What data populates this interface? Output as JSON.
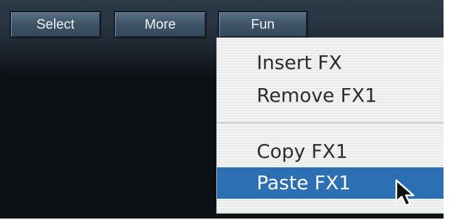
{
  "toolbar": {
    "buttons": [
      {
        "label": "Select"
      },
      {
        "label": "More"
      },
      {
        "label": "Fun"
      }
    ]
  },
  "menu": {
    "items": [
      {
        "label": "Insert FX"
      },
      {
        "label": "Remove FX1"
      },
      {
        "label": "Copy FX1"
      },
      {
        "label": "Paste FX1",
        "highlighted": true
      }
    ]
  },
  "colors": {
    "background": "#0c1115",
    "toolbar_button": "#3f5668",
    "menu_background": "#eceeef",
    "menu_highlight": "#2c6fb3",
    "menu_text": "#2a2c2e"
  },
  "icons": {
    "cursor": "arrow-pointer-icon"
  }
}
